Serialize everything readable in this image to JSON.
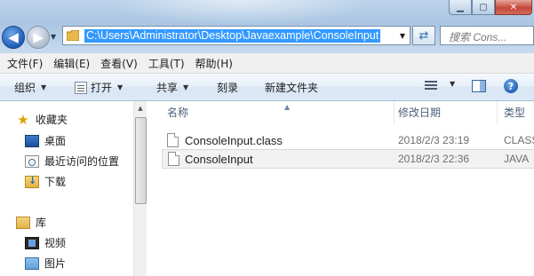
{
  "address": {
    "path": "C:\\Users\\Administrator\\Desktop\\Javaexample\\ConsoleInput",
    "search_placeholder": "搜索 Cons..."
  },
  "menu": [
    "文件(F)",
    "编辑(E)",
    "查看(V)",
    "工具(T)",
    "帮助(H)"
  ],
  "toolbar": {
    "organize": "组织",
    "open": "打开",
    "share": "共享",
    "burn": "刻录",
    "new_folder": "新建文件夹"
  },
  "nav": {
    "favorites": "收藏夹",
    "desktop": "桌面",
    "recent": "最近访问的位置",
    "downloads": "下载",
    "libraries": "库",
    "videos": "视频",
    "pictures": "图片"
  },
  "columns": {
    "name": "名称",
    "date": "修改日期",
    "type": "类型"
  },
  "files": [
    {
      "name": "ConsoleInput.class",
      "date": "2018/2/3 23:19",
      "type": "CLASS"
    },
    {
      "name": "ConsoleInput",
      "date": "2018/2/3 22:36",
      "type": "JAVA"
    }
  ],
  "colors": {
    "selection": "#3399ff",
    "accent": "#1d5db5"
  }
}
